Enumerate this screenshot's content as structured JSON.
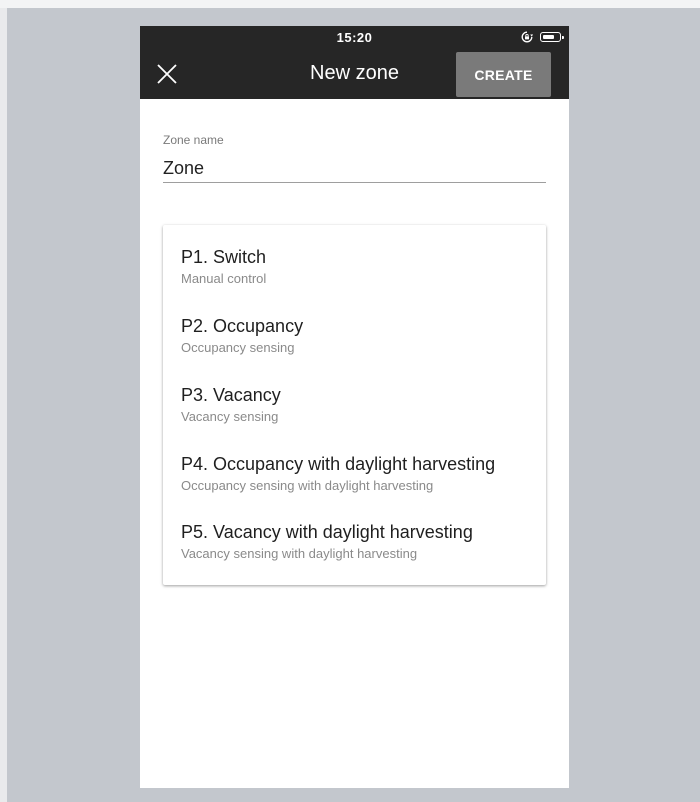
{
  "status_bar": {
    "time": "15:20"
  },
  "app_bar": {
    "title": "New zone",
    "create_label": "CREATE"
  },
  "form": {
    "zone_name_label": "Zone name",
    "zone_name_value": "Zone"
  },
  "programs": [
    {
      "title": "P1. Switch",
      "subtitle": "Manual control"
    },
    {
      "title": "P2. Occupancy",
      "subtitle": "Occupancy sensing"
    },
    {
      "title": "P3. Vacancy",
      "subtitle": "Vacancy sensing"
    },
    {
      "title": "P4. Occupancy with daylight harvesting",
      "subtitle": "Occupancy sensing with daylight harvesting"
    },
    {
      "title": "P5. Vacancy with daylight harvesting",
      "subtitle": "Vacancy sensing with daylight harvesting"
    }
  ],
  "icons": {
    "close": "close-icon",
    "orientation_lock": "orientation-lock-icon",
    "battery": "battery-icon"
  },
  "colors": {
    "app_bar": "#262626",
    "create_button": "#7a7a7a",
    "background": "#c3c7cd"
  }
}
